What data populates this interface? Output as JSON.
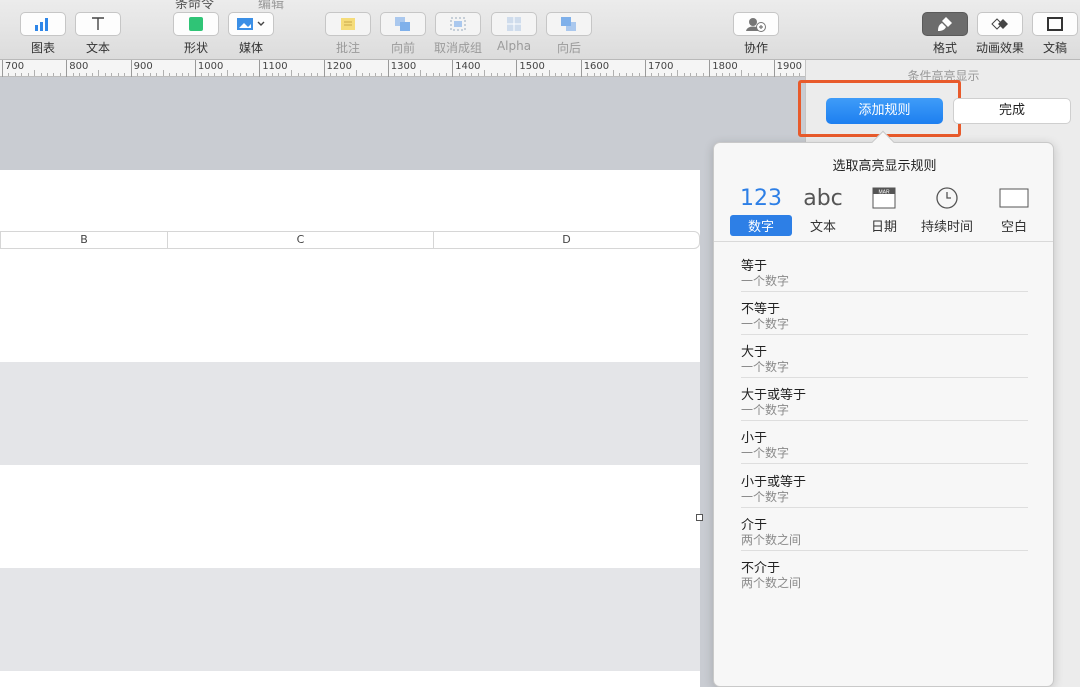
{
  "toolbar": {
    "top_text_left": "条命令",
    "top_text_right": "编辑",
    "items": [
      {
        "label": "图表",
        "icon": "chart-icon"
      },
      {
        "label": "文本",
        "icon": "text-icon"
      },
      {
        "label": "形状",
        "icon": "shape-icon"
      },
      {
        "label": "媒体",
        "icon": "media-icon"
      },
      {
        "label": "批注",
        "icon": "comment-icon"
      },
      {
        "label": "向前",
        "icon": "bring-forward-icon"
      },
      {
        "label": "取消成组",
        "icon": "ungroup-icon"
      },
      {
        "label": "Alpha",
        "icon": "alpha-icon"
      },
      {
        "label": "向后",
        "icon": "send-backward-icon"
      },
      {
        "label": "协作",
        "icon": "collaborate-icon"
      },
      {
        "label": "格式",
        "icon": "format-brush-icon"
      },
      {
        "label": "动画效果",
        "icon": "animate-icon"
      },
      {
        "label": "文稿",
        "icon": "document-icon"
      }
    ]
  },
  "ruler": {
    "labels": [
      "700",
      "800",
      "900",
      "1000",
      "1100",
      "1200",
      "1300",
      "1400",
      "1500",
      "1600",
      "1700",
      "1800",
      "1900"
    ]
  },
  "table": {
    "columns": [
      "B",
      "C",
      "D"
    ]
  },
  "side_panel": {
    "title": "条件高亮显示",
    "add_rule_label": "添加规则",
    "done_label": "完成"
  },
  "popover": {
    "title": "选取高亮显示规则",
    "categories": [
      {
        "glyph": "123",
        "label": "数字",
        "active": true
      },
      {
        "glyph": "abc",
        "label": "文本",
        "active": false
      },
      {
        "glyph": "MAR",
        "label": "日期",
        "active": false
      },
      {
        "glyph": "",
        "label": "持续时间",
        "active": false
      },
      {
        "glyph": "",
        "label": "空白",
        "active": false
      }
    ],
    "rules": [
      {
        "name": "等于",
        "desc": "一个数字"
      },
      {
        "name": "不等于",
        "desc": "一个数字"
      },
      {
        "name": "大于",
        "desc": "一个数字"
      },
      {
        "name": "大于或等于",
        "desc": "一个数字"
      },
      {
        "name": "小于",
        "desc": "一个数字"
      },
      {
        "name": "小于或等于",
        "desc": "一个数字"
      },
      {
        "name": "介于",
        "desc": "两个数之间"
      },
      {
        "name": "不介于",
        "desc": "两个数之间"
      }
    ]
  },
  "colors": {
    "accent": "#2d7fe6",
    "highlight_border": "#e85a2b"
  }
}
